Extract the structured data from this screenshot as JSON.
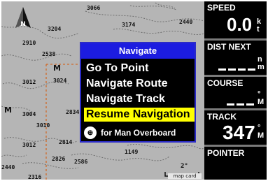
{
  "map": {
    "elevations": [
      "3066",
      "3174",
      "3204",
      "2910",
      "2440",
      "2538",
      "3012",
      "3024",
      "2834",
      "3004",
      "3010",
      "2814",
      "3012",
      "2826",
      "2586",
      "1149",
      "2440",
      "2316"
    ],
    "letters": [
      "M",
      "M"
    ],
    "scale_label": "2°",
    "map_card_label": "map card"
  },
  "dialog": {
    "title": "Navigate",
    "items": [
      "Go To Point",
      "Navigate Route",
      "Navigate Track",
      "Resume Navigation"
    ],
    "selected_index": 3,
    "mob_label": "for Man Overboard",
    "mob_icon": "man-overboard-icon"
  },
  "panel": {
    "speed": {
      "label": "SPEED",
      "value": "0.0",
      "unit_top": "k",
      "unit_bottom": "t"
    },
    "dist_next": {
      "label": "DIST NEXT",
      "value": "",
      "unit_top": "n",
      "unit_bottom": "m"
    },
    "course": {
      "label": "COURSE",
      "value": "",
      "unit_top": "°",
      "unit_bottom": "M"
    },
    "track": {
      "label": "TRACK",
      "value": "347",
      "unit_top": "°",
      "unit_bottom": "M"
    },
    "pointer": {
      "label": "POINTER"
    }
  },
  "colors": {
    "title_bar": "#1c1ce0",
    "selection": "#ffff00",
    "panel": "#000000",
    "map": "#b5b5b5",
    "route": "#d06a2a"
  }
}
